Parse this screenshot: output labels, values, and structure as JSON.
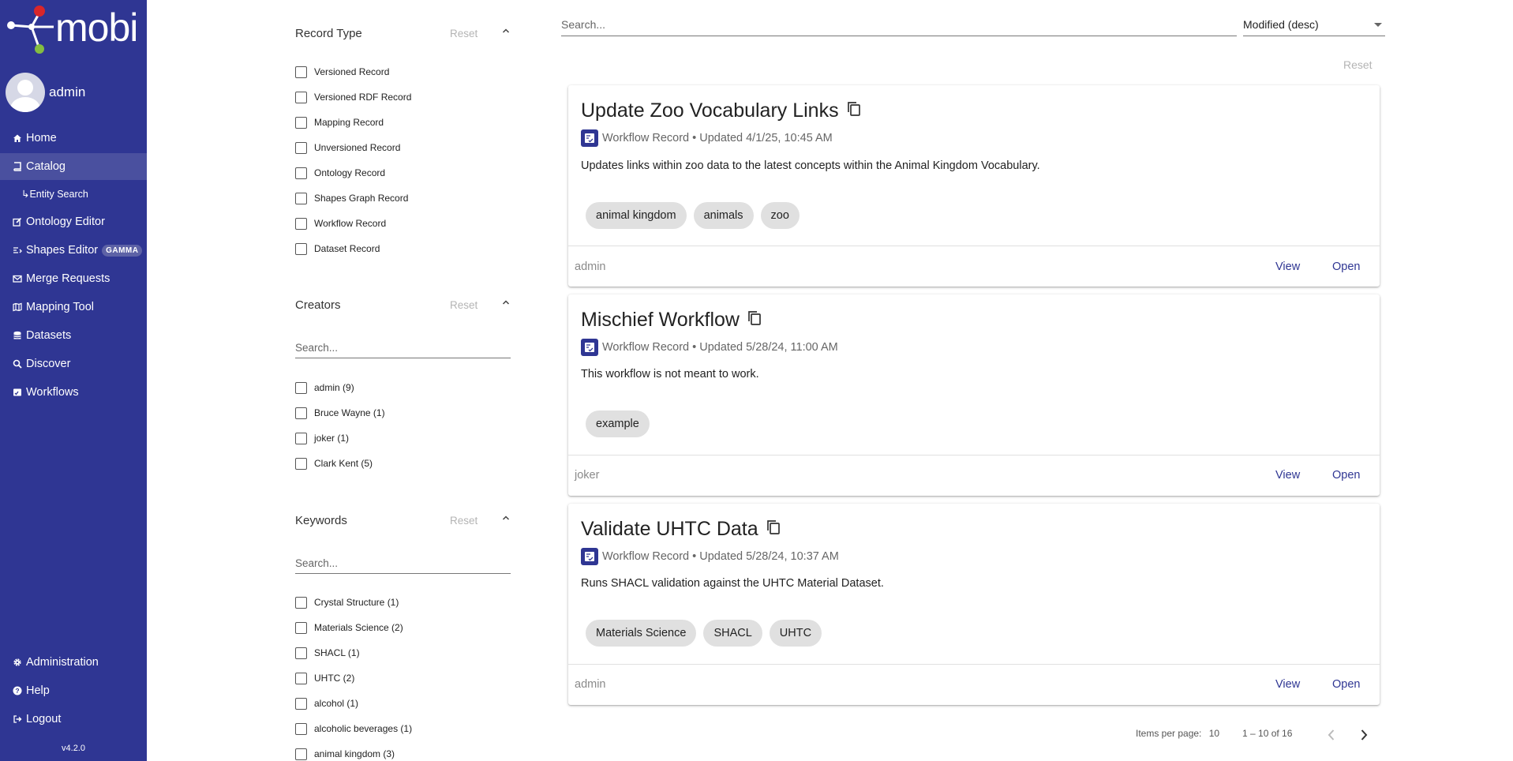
{
  "app": {
    "logo_text": "mobi",
    "version": "v4.2.0"
  },
  "user": {
    "name": "admin"
  },
  "nav": {
    "home": "Home",
    "catalog": "Catalog",
    "entity_search": "↳Entity Search",
    "ontology_editor": "Ontology Editor",
    "shapes_editor": "Shapes Editor",
    "shapes_badge": "GAMMA",
    "merge_requests": "Merge Requests",
    "mapping_tool": "Mapping Tool",
    "datasets": "Datasets",
    "discover": "Discover",
    "workflows": "Workflows",
    "administration": "Administration",
    "help": "Help",
    "logout": "Logout"
  },
  "filters": {
    "record_type": {
      "title": "Record Type",
      "reset": "Reset",
      "options": [
        "Versioned Record",
        "Versioned RDF Record",
        "Mapping Record",
        "Unversioned Record",
        "Ontology Record",
        "Shapes Graph Record",
        "Workflow Record",
        "Dataset Record"
      ]
    },
    "creators": {
      "title": "Creators",
      "reset": "Reset",
      "search_placeholder": "Search...",
      "options": [
        "admin (9)",
        "Bruce Wayne (1)",
        "joker (1)",
        "Clark Kent (5)"
      ]
    },
    "keywords": {
      "title": "Keywords",
      "reset": "Reset",
      "search_placeholder": "Search...",
      "options": [
        "Crystal Structure (1)",
        "Materials Science (2)",
        "SHACL (1)",
        "UHTC (2)",
        "alcohol (1)",
        "alcoholic beverages (1)",
        "animal kingdom (3)"
      ]
    }
  },
  "main": {
    "search_placeholder": "Search...",
    "sort_value": "Modified (desc)",
    "reset": "Reset",
    "records": [
      {
        "title": "Update Zoo Vocabulary Links",
        "meta": "Workflow Record • Updated 4/1/25, 10:45 AM",
        "description": "Updates links within zoo data to the latest concepts within the Animal Kingdom Vocabulary.",
        "keywords": [
          "animal kingdom",
          "animals",
          "zoo"
        ],
        "creator": "admin",
        "view": "View",
        "open": "Open"
      },
      {
        "title": "Mischief Workflow",
        "meta": "Workflow Record • Updated 5/28/24, 11:00 AM",
        "description": "This workflow is not meant to work.",
        "keywords": [
          "example"
        ],
        "creator": "joker",
        "view": "View",
        "open": "Open"
      },
      {
        "title": "Validate UHTC Data",
        "meta": "Workflow Record • Updated 5/28/24, 10:37 AM",
        "description": "Runs SHACL validation against the UHTC Material Dataset.",
        "keywords": [
          "Materials Science",
          "SHACL",
          "UHTC"
        ],
        "creator": "admin",
        "view": "View",
        "open": "Open"
      }
    ],
    "pager": {
      "items_per_page_label": "Items per page:",
      "items_per_page_value": "10",
      "range": "1 – 10 of 16"
    }
  },
  "colors": {
    "sidebar": "#2f3693",
    "accent": "#2f3693",
    "active_nav": "#4a509f"
  }
}
